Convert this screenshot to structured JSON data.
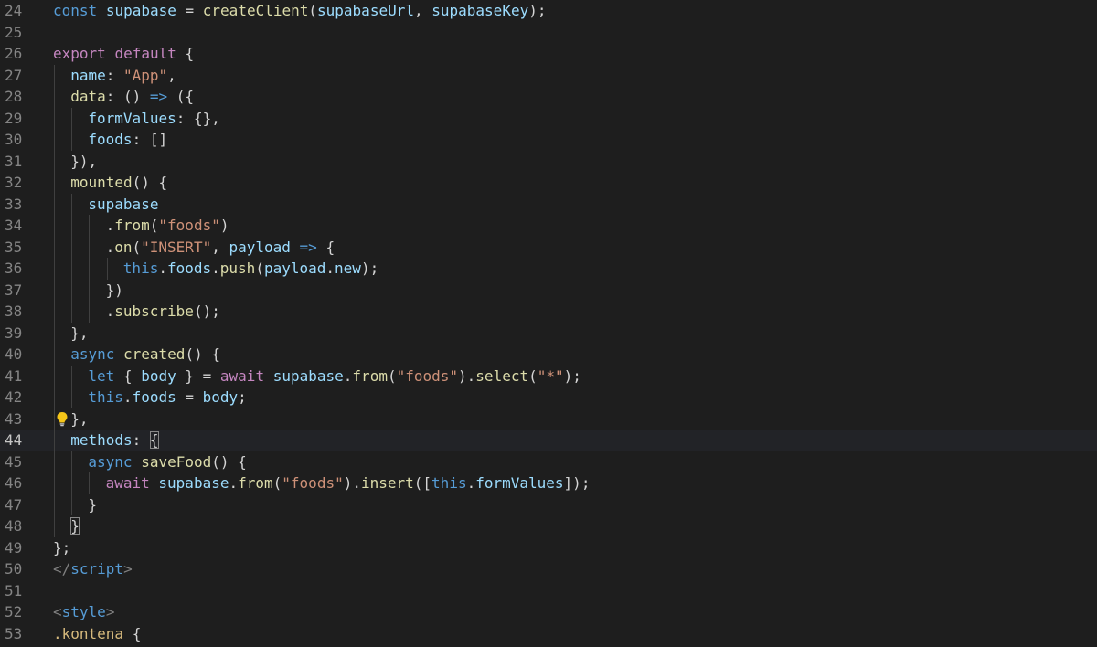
{
  "editor": {
    "theme": "dark",
    "colors": {
      "background": "#1e1e1e",
      "line_number": "#858585",
      "keyword": "#c586c0",
      "storage": "#569cd6",
      "variable": "#9cdcfe",
      "function": "#dcdcaa",
      "string": "#ce9178",
      "punctuation": "#d4d4d4",
      "tag_bracket": "#808080",
      "selector": "#d7ba7d"
    },
    "lightbulb_icon": "lightbulb-icon",
    "lines": [
      {
        "n": "24",
        "indent": 0,
        "tokens": [
          [
            "st",
            "const"
          ],
          [
            "pun",
            " "
          ],
          [
            "var",
            "supabase"
          ],
          [
            "pun",
            " = "
          ],
          [
            "fn",
            "createClient"
          ],
          [
            "pun",
            "("
          ],
          [
            "var",
            "supabaseUrl"
          ],
          [
            "pun",
            ", "
          ],
          [
            "var",
            "supabaseKey"
          ],
          [
            "pun",
            ");"
          ]
        ]
      },
      {
        "n": "25",
        "indent": 0,
        "tokens": []
      },
      {
        "n": "26",
        "indent": 0,
        "tokens": [
          [
            "kw",
            "export"
          ],
          [
            "pun",
            " "
          ],
          [
            "kw",
            "default"
          ],
          [
            "pun",
            " {"
          ]
        ]
      },
      {
        "n": "27",
        "indent": 1,
        "tokens": [
          [
            "var",
            "name"
          ],
          [
            "pun",
            ": "
          ],
          [
            "str",
            "\"App\""
          ],
          [
            "pun",
            ","
          ]
        ]
      },
      {
        "n": "28",
        "indent": 1,
        "tokens": [
          [
            "fn",
            "data"
          ],
          [
            "pun",
            ": () "
          ],
          [
            "st",
            "=>"
          ],
          [
            "pun",
            " ({"
          ]
        ]
      },
      {
        "n": "29",
        "indent": 2,
        "tokens": [
          [
            "var",
            "formValues"
          ],
          [
            "pun",
            ": {},"
          ]
        ]
      },
      {
        "n": "30",
        "indent": 2,
        "tokens": [
          [
            "var",
            "foods"
          ],
          [
            "pun",
            ": []"
          ]
        ]
      },
      {
        "n": "31",
        "indent": 1,
        "tokens": [
          [
            "pun",
            "}),"
          ]
        ]
      },
      {
        "n": "32",
        "indent": 1,
        "tokens": [
          [
            "fn",
            "mounted"
          ],
          [
            "pun",
            "() {"
          ]
        ]
      },
      {
        "n": "33",
        "indent": 2,
        "tokens": [
          [
            "var",
            "supabase"
          ]
        ]
      },
      {
        "n": "34",
        "indent": 3,
        "tokens": [
          [
            "pun",
            "."
          ],
          [
            "fn",
            "from"
          ],
          [
            "pun",
            "("
          ],
          [
            "str",
            "\"foods\""
          ],
          [
            "pun",
            ")"
          ]
        ]
      },
      {
        "n": "35",
        "indent": 3,
        "tokens": [
          [
            "pun",
            "."
          ],
          [
            "fn",
            "on"
          ],
          [
            "pun",
            "("
          ],
          [
            "str",
            "\"INSERT\""
          ],
          [
            "pun",
            ", "
          ],
          [
            "var",
            "payload"
          ],
          [
            "pun",
            " "
          ],
          [
            "st",
            "=>"
          ],
          [
            "pun",
            " {"
          ]
        ]
      },
      {
        "n": "36",
        "indent": 4,
        "tokens": [
          [
            "st",
            "this"
          ],
          [
            "pun",
            "."
          ],
          [
            "var",
            "foods"
          ],
          [
            "pun",
            "."
          ],
          [
            "fn",
            "push"
          ],
          [
            "pun",
            "("
          ],
          [
            "var",
            "payload"
          ],
          [
            "pun",
            "."
          ],
          [
            "var",
            "new"
          ],
          [
            "pun",
            ");"
          ]
        ]
      },
      {
        "n": "37",
        "indent": 3,
        "tokens": [
          [
            "pun",
            "})"
          ]
        ]
      },
      {
        "n": "38",
        "indent": 3,
        "tokens": [
          [
            "pun",
            "."
          ],
          [
            "fn",
            "subscribe"
          ],
          [
            "pun",
            "();"
          ]
        ]
      },
      {
        "n": "39",
        "indent": 1,
        "tokens": [
          [
            "pun",
            "},"
          ]
        ]
      },
      {
        "n": "40",
        "indent": 1,
        "tokens": [
          [
            "st",
            "async"
          ],
          [
            "pun",
            " "
          ],
          [
            "fn",
            "created"
          ],
          [
            "pun",
            "() {"
          ]
        ]
      },
      {
        "n": "41",
        "indent": 2,
        "tokens": [
          [
            "st",
            "let"
          ],
          [
            "pun",
            " { "
          ],
          [
            "var",
            "body"
          ],
          [
            "pun",
            " } = "
          ],
          [
            "kw",
            "await"
          ],
          [
            "pun",
            " "
          ],
          [
            "var",
            "supabase"
          ],
          [
            "pun",
            "."
          ],
          [
            "fn",
            "from"
          ],
          [
            "pun",
            "("
          ],
          [
            "str",
            "\"foods\""
          ],
          [
            "pun",
            ")."
          ],
          [
            "fn",
            "select"
          ],
          [
            "pun",
            "("
          ],
          [
            "str",
            "\"*\""
          ],
          [
            "pun",
            ");"
          ]
        ]
      },
      {
        "n": "42",
        "indent": 2,
        "tokens": [
          [
            "st",
            "this"
          ],
          [
            "pun",
            "."
          ],
          [
            "var",
            "foods"
          ],
          [
            "pun",
            " = "
          ],
          [
            "var",
            "body"
          ],
          [
            "pun",
            ";"
          ]
        ]
      },
      {
        "n": "43",
        "indent": 1,
        "tokens": [
          [
            "pun",
            "},"
          ]
        ],
        "lightbulb": true
      },
      {
        "n": "44",
        "indent": 1,
        "tokens": [
          [
            "var",
            "methods"
          ],
          [
            "pun",
            ": "
          ],
          [
            "bm",
            "{"
          ]
        ],
        "active": true
      },
      {
        "n": "45",
        "indent": 2,
        "tokens": [
          [
            "st",
            "async"
          ],
          [
            "pun",
            " "
          ],
          [
            "fn",
            "saveFood"
          ],
          [
            "pun",
            "() {"
          ]
        ]
      },
      {
        "n": "46",
        "indent": 3,
        "tokens": [
          [
            "kw",
            "await"
          ],
          [
            "pun",
            " "
          ],
          [
            "var",
            "supabase"
          ],
          [
            "pun",
            "."
          ],
          [
            "fn",
            "from"
          ],
          [
            "pun",
            "("
          ],
          [
            "str",
            "\"foods\""
          ],
          [
            "pun",
            ")."
          ],
          [
            "fn",
            "insert"
          ],
          [
            "pun",
            "(["
          ],
          [
            "st",
            "this"
          ],
          [
            "pun",
            "."
          ],
          [
            "var",
            "formValues"
          ],
          [
            "pun",
            "]);"
          ]
        ]
      },
      {
        "n": "47",
        "indent": 2,
        "tokens": [
          [
            "pun",
            "}"
          ]
        ]
      },
      {
        "n": "48",
        "indent": 1,
        "tokens": [
          [
            "bm",
            "}"
          ]
        ]
      },
      {
        "n": "49",
        "indent": 0,
        "tokens": [
          [
            "pun",
            "};"
          ]
        ]
      },
      {
        "n": "50",
        "indent": 0,
        "tokens": [
          [
            "tag",
            "</"
          ],
          [
            "tagname",
            "script"
          ],
          [
            "tag",
            ">"
          ]
        ]
      },
      {
        "n": "51",
        "indent": 0,
        "tokens": []
      },
      {
        "n": "52",
        "indent": 0,
        "tokens": [
          [
            "tag",
            "<"
          ],
          [
            "tagname",
            "style"
          ],
          [
            "tag",
            ">"
          ]
        ]
      },
      {
        "n": "53",
        "indent": 0,
        "tokens": [
          [
            "cls",
            ".kontena"
          ],
          [
            "pun",
            " {"
          ]
        ]
      }
    ]
  }
}
